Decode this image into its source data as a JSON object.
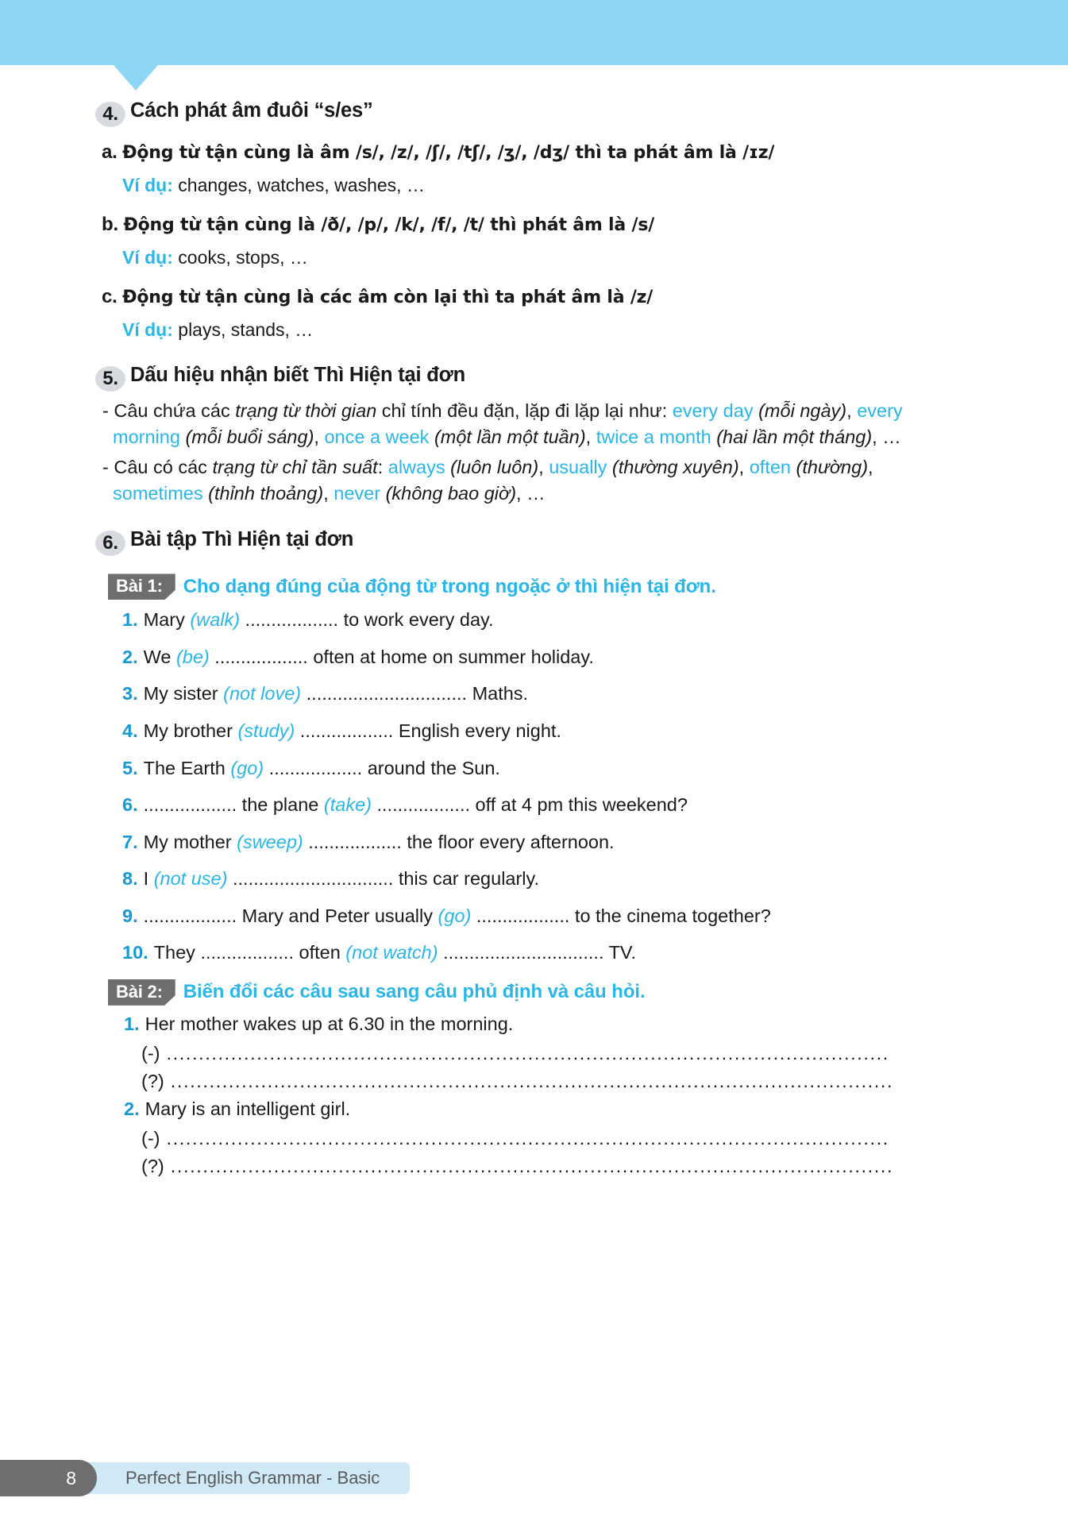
{
  "colors": {
    "banner": "#8DD6F5",
    "accent_cyan": "#29B6E8",
    "number_blue": "#1599D6",
    "badge_gray": "#6E6E6E",
    "circle_gray": "#d7dade",
    "footer_band": "#CFE9F7"
  },
  "section4": {
    "number": "4.",
    "title": "Cách phát âm đuôi “s/es”",
    "rules": [
      {
        "label": "a.",
        "text": "Động từ tận cùng là âm /s/, /z/, /ʃ/, /tʃ/, /ʒ/, /dʒ/ thì ta phát âm là /ɪz/",
        "example_label": "Ví dụ:",
        "example_text": "changes, watches, washes, …"
      },
      {
        "label": "b.",
        "text": "Động từ tận cùng là /ð/, /p/, /k/, /f/, /t/ thì phát âm là /s/",
        "example_label": "Ví dụ:",
        "example_text": "cooks, stops, …"
      },
      {
        "label": "c.",
        "text": "Động từ tận cùng là các âm còn lại thì ta phát âm là /z/",
        "example_label": "Ví dụ:",
        "example_text": "plays, stands, …"
      }
    ]
  },
  "section5": {
    "number": "5.",
    "title": "Dấu hiệu nhận biết Thì Hiện tại đơn",
    "bullet1": {
      "lead": "- Câu chứa các ",
      "italic_term": "trạng từ thời gian",
      "mid": " chỉ tính đều đặn, lặp đi lặp lại như: ",
      "items": [
        {
          "en": "every day",
          "vi": "(mỗi ngày)"
        },
        {
          "en": "every morning",
          "vi": "(mỗi buổi sáng)"
        },
        {
          "en": "once a week",
          "vi": "(một lần một tuần)"
        },
        {
          "en": "twice a month",
          "vi": "(hai lần một tháng)"
        }
      ],
      "tail": ", …"
    },
    "bullet2": {
      "lead": "- Câu có các ",
      "italic_term": "trạng từ chỉ tần suất",
      "mid": ": ",
      "items": [
        {
          "en": "always",
          "vi": "(luôn luôn)"
        },
        {
          "en": "usually",
          "vi": "(thường xuyên)"
        },
        {
          "en": "often",
          "vi": "(thường)"
        },
        {
          "en": "sometimes",
          "vi": "(thỉnh thoảng)"
        },
        {
          "en": "never",
          "vi": "(không bao giờ)"
        }
      ],
      "tail": ", …"
    }
  },
  "section6": {
    "number": "6.",
    "title": "Bài tập Thì Hiện tại đơn"
  },
  "bai1": {
    "badge": "Bài 1:",
    "title": "Cho dạng đúng của động từ trong ngoặc ở thì hiện tại đơn.",
    "items": [
      {
        "num": "1.",
        "pre": "Mary ",
        "verb": "(walk)",
        "post": " .................. to work every day."
      },
      {
        "num": "2.",
        "pre": "We ",
        "verb": "(be)",
        "post": " .................. often at home on summer holiday."
      },
      {
        "num": "3.",
        "pre": "My sister ",
        "verb": "(not love)",
        "post": " ............................... Maths."
      },
      {
        "num": "4.",
        "pre": "My brother ",
        "verb": "(study)",
        "post": " .................. English every night."
      },
      {
        "num": "5.",
        "pre": "The Earth ",
        "verb": "(go)",
        "post": " .................. around the Sun."
      },
      {
        "num": "6.",
        "pre": " .................. the plane ",
        "verb": "(take)",
        "post": " .................. off at 4 pm this weekend?"
      },
      {
        "num": "7.",
        "pre": "My mother ",
        "verb": "(sweep)",
        "post": " .................. the floor every afternoon."
      },
      {
        "num": "8.",
        "pre": "I ",
        "verb": "(not use)",
        "post": " ............................... this car regularly."
      },
      {
        "num": "9.",
        "pre": " .................. Mary and Peter usually ",
        "verb": "(go)",
        "post": " .................. to the cinema together?"
      },
      {
        "num": "10.",
        "pre": "They .................. often ",
        "verb": "(not watch)",
        "post": " ............................... TV."
      }
    ]
  },
  "bai2": {
    "badge": "Bài 2:",
    "title": "Biến đổi các câu sau sang câu phủ định và câu hỏi.",
    "questions": [
      {
        "num": "1.",
        "sentence": "Her mother wakes up at 6.30 in the morning.",
        "answers": [
          {
            "tag": "(-)",
            "dots": "................................................................................................................"
          },
          {
            "tag": "(?)",
            "dots": "................................................................................................................"
          }
        ]
      },
      {
        "num": "2.",
        "sentence": "Mary is an intelligent girl.",
        "answers": [
          {
            "tag": "(-)",
            "dots": "................................................................................................................"
          },
          {
            "tag": "(?)",
            "dots": "................................................................................................................"
          }
        ]
      }
    ]
  },
  "footer": {
    "page_number": "8",
    "book_title": "Perfect English Grammar - Basic"
  }
}
